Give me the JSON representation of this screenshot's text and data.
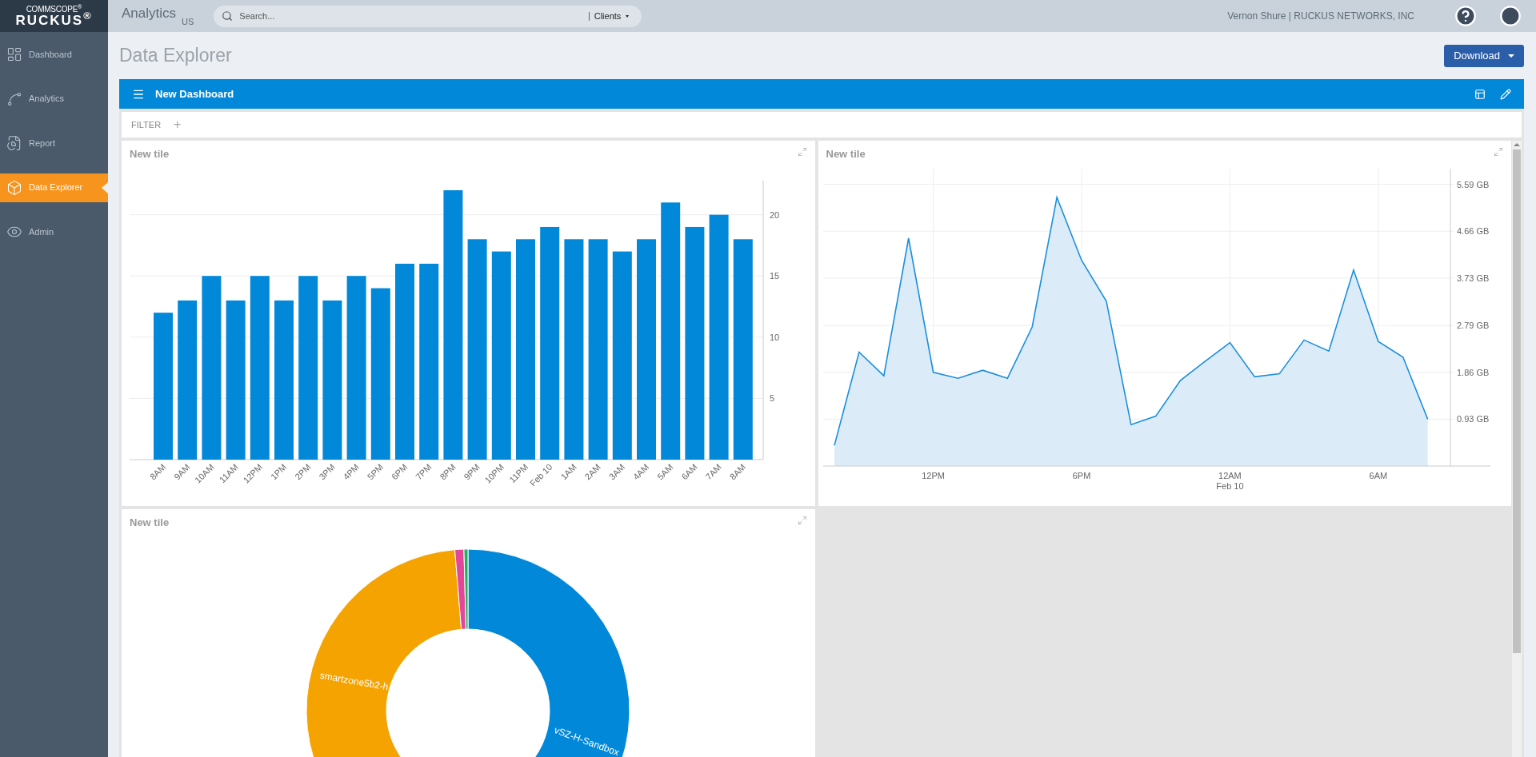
{
  "logo": {
    "top": "COMMSCOPE$^{®}$",
    "main": "RUCKUS$^{®}$"
  },
  "sidebar": {
    "items": [
      {
        "label": "Dashboard",
        "kind": "dashboard",
        "selected": false
      },
      {
        "label": "Analytics",
        "kind": "analytics",
        "selected": false
      },
      {
        "label": "Report",
        "kind": "report",
        "selected": false
      },
      {
        "label": "Data Explorer",
        "kind": "explorer",
        "selected": true
      },
      {
        "label": "Admin",
        "kind": "admin",
        "selected": false
      }
    ]
  },
  "topbar": {
    "app": "Analytics",
    "region": "US",
    "search": {
      "placeholder": "Search..."
    },
    "scope": "Clients",
    "user": "Vernon Shure | RUCKUS NETWORKS, INC"
  },
  "page": {
    "title": "Data Explorer",
    "download": "Download"
  },
  "dashboard": {
    "title": "New Dashboard",
    "filter": "FILTER",
    "filter_add": "+"
  },
  "tiles": [
    {
      "kind": "chart",
      "title": "New tile",
      "chart_data": {
        "type": "bar",
        "categories": [
          "8AM",
          "9AM",
          "10AM",
          "11AM",
          "12PM",
          "1PM",
          "2PM",
          "3PM",
          "4PM",
          "5PM",
          "6PM",
          "7PM",
          "8PM",
          "9PM",
          "10PM",
          "11PM",
          "Feb 10",
          "1AM",
          "2AM",
          "3AM",
          "4AM",
          "5AM",
          "6AM",
          "7AM",
          "8AM"
        ],
        "series": [
          {
            "color": "#0288d9",
            "values": [
              12,
              13,
              15,
              13,
              15,
              13,
              15,
              13,
              15,
              14,
              16,
              16,
              22,
              18,
              17,
              18,
              19,
              18,
              18,
              17,
              18,
              21,
              19,
              20,
              18
            ]
          }
        ],
        "ylim": [
          0,
          22
        ],
        "yticks": [
          5,
          10,
          15,
          20
        ],
        "grid": true
      }
    },
    {
      "kind": "chart",
      "title": "New tile",
      "chart_data": {
        "type": "area",
        "grid": true,
        "categories": [
          null,
          null,
          null,
          null,
          "12PM",
          null,
          null,
          null,
          null,
          null,
          "6PM",
          null,
          null,
          null,
          null,
          null,
          "12AM",
          null,
          null,
          null,
          null,
          null,
          "6AM",
          null,
          null
        ],
        "series": [
          {
            "color": "#1a8fdd",
            "values": [
              0.41,
              2.26,
              1.79,
              4.52,
              1.86,
              1.74,
              1.9,
              1.74,
              2.76,
              5.33,
              4.08,
              3.27,
              0.82,
              0.99,
              1.7,
              2.08,
              2.45,
              1.77,
              1.83,
              2.5,
              2.28,
              3.89,
              2.47,
              2.16,
              0.93
            ]
          }
        ],
        "ylim": [
          0,
          5.9
        ],
        "yticks": [
          {
            "value": 0.93,
            "label": "0.93 GB"
          },
          {
            "value": 1.86,
            "label": "1.86 GB"
          },
          {
            "value": 2.79,
            "label": "2.79 GB"
          },
          {
            "value": 3.73,
            "label": "3.73 GB"
          },
          {
            "value": 4.66,
            "label": "4.66 GB"
          },
          {
            "value": 5.59,
            "label": "5.59 GB"
          }
        ],
        "annotations": [
          "Feb 10"
        ]
      }
    },
    {
      "kind": "donut",
      "title": "New tile",
      "slices": [
        {
          "label": "vSZ-H-Sandbox",
          "color": "#0288d9"
        },
        {
          "label": "smartzone5b2-h",
          "color": "#f4a300"
        },
        {
          "color": "#e3479a"
        },
        {
          "color": "#27ae60"
        }
      ]
    }
  ]
}
